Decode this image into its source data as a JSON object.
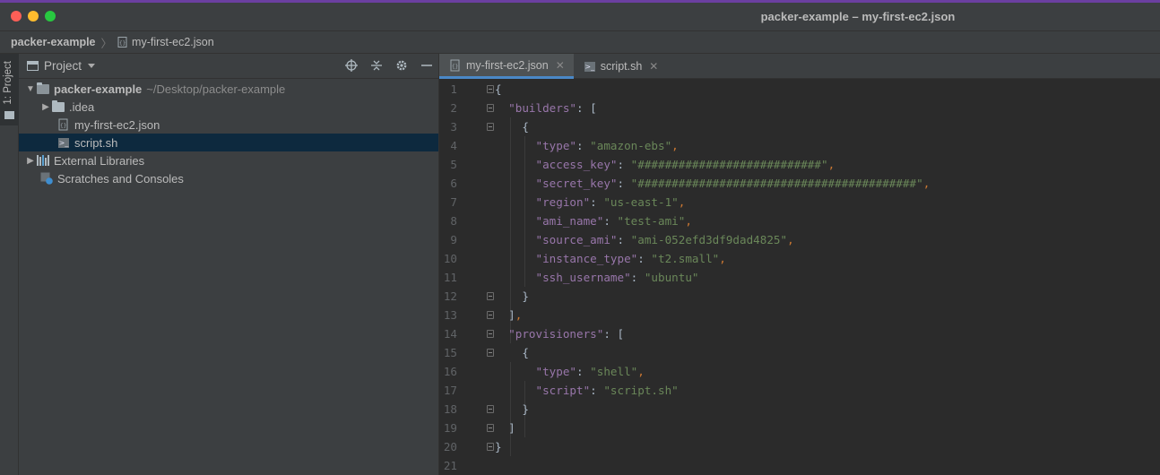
{
  "window": {
    "title": "packer-example – my-first-ec2.json"
  },
  "breadcrumbs": {
    "project": "packer-example",
    "file": "my-first-ec2.json"
  },
  "toolstrip": {
    "label": "1: Project"
  },
  "project_panel": {
    "title": "Project",
    "tree": [
      {
        "label": "packer-example",
        "hint": "~/Desktop/packer-example"
      },
      {
        "label": ".idea"
      },
      {
        "label": "my-first-ec2.json"
      },
      {
        "label": "script.sh"
      },
      {
        "label": "External Libraries"
      },
      {
        "label": "Scratches and Consoles"
      }
    ]
  },
  "tabs": [
    {
      "label": "my-first-ec2.json",
      "active": true
    },
    {
      "label": "script.sh",
      "active": false
    }
  ],
  "code": {
    "line_numbers": [
      "1",
      "2",
      "3",
      "4",
      "5",
      "6",
      "7",
      "8",
      "9",
      "10",
      "11",
      "12",
      "13",
      "14",
      "15",
      "16",
      "17",
      "18",
      "19",
      "20",
      "21"
    ],
    "builders_key": "\"builders\"",
    "provisioners_key": "\"provisioners\"",
    "builder": [
      {
        "key": "\"type\"",
        "value": "\"amazon-ebs\""
      },
      {
        "key": "\"access_key\"",
        "value": "\"###########################\""
      },
      {
        "key": "\"secret_key\"",
        "value": "\"#########################################\""
      },
      {
        "key": "\"region\"",
        "value": "\"us-east-1\""
      },
      {
        "key": "\"ami_name\"",
        "value": "\"test-ami\""
      },
      {
        "key": "\"source_ami\"",
        "value": "\"ami-052efd3df9dad4825\""
      },
      {
        "key": "\"instance_type\"",
        "value": "\"t2.small\""
      },
      {
        "key": "\"ssh_username\"",
        "value": "\"ubuntu\""
      }
    ],
    "provisioner": [
      {
        "key": "\"type\"",
        "value": "\"shell\""
      },
      {
        "key": "\"script\"",
        "value": "\"script.sh\""
      }
    ]
  },
  "colors": {
    "key": "#9876aa",
    "string": "#6a8759",
    "accent": "#4a88c7",
    "selection": "#0d293e"
  }
}
